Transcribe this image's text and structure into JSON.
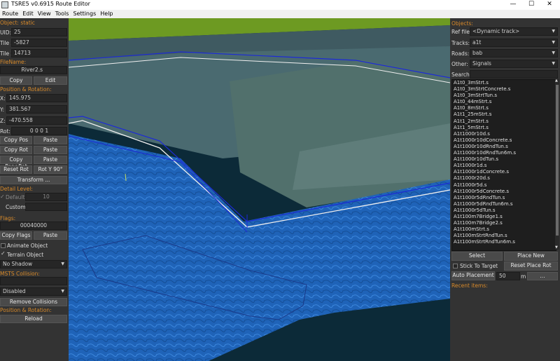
{
  "window": {
    "title": "TSRE5 v0.6915 Route Editor",
    "minimize": "—",
    "maximize": "☐",
    "close": "✕"
  },
  "menu": [
    "Route",
    "Edit",
    "View",
    "Tools",
    "Settings",
    "Help"
  ],
  "left": {
    "object_label": "Object: static",
    "uid_label": "UID:",
    "uid_value": "25",
    "tile_x_label": "Tile X:",
    "tile_x_value": "-5827",
    "tile_z_label": "Tile Z:",
    "tile_z_value": "14713",
    "filename_label": "FileName:",
    "filename_value": "River2.s",
    "copy": "Copy",
    "edit": "Edit",
    "pos_rot_label": "Position & Rotation:",
    "x_label": "X:",
    "x_value": "145.975",
    "y_label": "Y:",
    "y_value": "381.567",
    "z_label": "Z:",
    "z_value": "-470.558",
    "rot_label": "Rot:",
    "rot_value": "0 0 0 1",
    "copy_pos": "Copy Pos",
    "paste1": "Paste",
    "copy_rot": "Copy Rot",
    "paste2": "Paste",
    "copy_pos_rot": "Copy Pos+Rot",
    "paste3": "Paste",
    "reset_rot": "Reset Rot",
    "rot_y90": "Rot Y 90°",
    "transform": "Transform ...",
    "detail_level_label": "Detail Level:",
    "default_label": "Default",
    "default_value": "10",
    "custom_label": "Custom",
    "flags_label": "Flags:",
    "flags_value": "00040000",
    "copy_flags": "Copy Flags",
    "paste4": "Paste",
    "animate_object": "Animate Object",
    "terrain_object": "Terrain Object",
    "shadow_value": "No Shadow",
    "msts_collision_label": "MSTS Collision:",
    "collision_value": "Disabled",
    "remove_collisions": "Remove Collisions",
    "pos_rot_label2": "Position & Rotation:",
    "reload": "Reload"
  },
  "right": {
    "objects_label": "Objects:",
    "ref_file_label": "Ref file:",
    "ref_file_value": "<Dynamic track>",
    "tracks_label": "Tracks:",
    "tracks_value": "a1t",
    "roads_label": "Roads:",
    "roads_value": "bab",
    "other_label": "Other:",
    "other_value": "Signals",
    "search_label": "Search:",
    "items": [
      "A1t0_3mStrt.s",
      "A1t0_3mStrtConcrete.s",
      "A1t0_3mStrtTun.s",
      "A1t0_44mStrt.s",
      "A1t0_8mStrt.s",
      "A1t1_25mStrt.s",
      "A1t1_2mStrt.s",
      "A1t1_5mStrt.s",
      "A1t1000r10d.s",
      "A1t1000r10dConcrete.s",
      "A1t1000r10dRndTun.s",
      "A1t1000r10dRndTun6m.s",
      "A1t1000r10dTun.s",
      "A1t1000r1d.s",
      "A1t1000r1dConcrete.s",
      "A1t1000r20d.s",
      "A1t1000r5d.s",
      "A1t1000r5dConcrete.s",
      "A1t1000r5dRndTun.s",
      "A1t1000r5dRndTun6m.s",
      "A1t1000r5dTun.s",
      "A1t100m7Bridge1.s",
      "A1t100m7Bridge2.s",
      "A1t100mStrt.s",
      "A1t100mStrtRndTun.s",
      "A1t100mStrtRndTun6m.s"
    ],
    "select": "Select",
    "place_new": "Place New",
    "stick_to_target": "Stick To Target",
    "reset_place_rot": "Reset Place Rot",
    "auto_placement": "Auto Placement",
    "auto_value": "50",
    "auto_unit": "m",
    "more": "...",
    "recent_items_label": "Recent items:"
  }
}
